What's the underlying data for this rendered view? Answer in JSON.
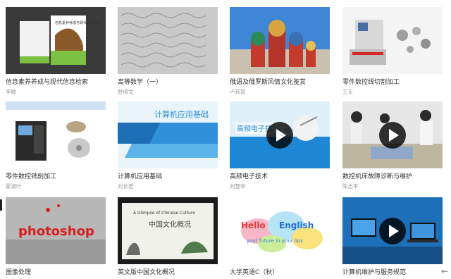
{
  "courses": [
    {
      "title": "信息素养养成与现代信息检索",
      "author": "李敏"
    },
    {
      "title": "高等数学（一）",
      "author": "舒倩文"
    },
    {
      "title": "俄语及俄罗斯风情文化鉴赏",
      "author": "卢莉霞"
    },
    {
      "title": "零件数控线切割加工",
      "author": "王东"
    },
    {
      "title": "零件数控铣削加工",
      "author": "霍淑叶"
    },
    {
      "title": "计算机应用基础",
      "author": "刘长君"
    },
    {
      "title": "高频电子技术",
      "author": "刘慧亭"
    },
    {
      "title": "数控机床故障诊断与维护",
      "author": "陈志平"
    },
    {
      "title": "图像处理",
      "author": ""
    },
    {
      "title": "英文版中国文化概况",
      "author": ""
    },
    {
      "title": "大学英语C（秋）",
      "author": ""
    },
    {
      "title": "计算机维护与服务规范",
      "author": ""
    }
  ],
  "thumbs": {
    "book_cover_title": "信息素养养成与现代信息检索",
    "computer_banner": "计算机应用基础",
    "hf_banner": "高频电子技",
    "photoshop_text": "photoshop",
    "culture_en": "A Glimpse of Chinese Culture",
    "culture_cn": "中国文化概况",
    "hello": "Hello",
    "english": "English",
    "sub_text": "your future in your lips"
  },
  "icons": {
    "play": "play-icon",
    "back": "back-arrow-icon"
  },
  "colors": {
    "play_bg": "#111111",
    "banner_blue": "#2f8fd8",
    "photoshop_red": "#d81e1e"
  }
}
